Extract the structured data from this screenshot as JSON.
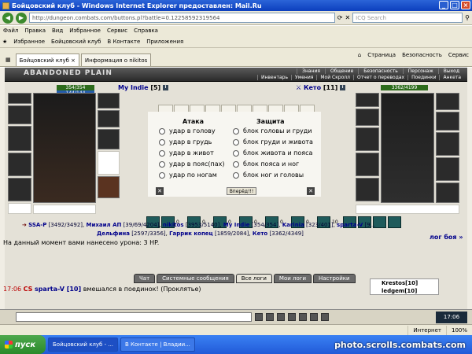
{
  "window": {
    "title": "Бойцовский клуб - Windows Internet Explorer предоставлен: Mail.Ru"
  },
  "address": {
    "url": "http://dungeon.combats.com/buttons.pl?battle=0.12258592319564",
    "search_placeholder": "ICQ Search"
  },
  "menu": [
    "Файл",
    "Правка",
    "Вид",
    "Избранное",
    "Сервис",
    "Справка"
  ],
  "favorites": {
    "label": "Избранное",
    "items": [
      "Бойцовский клуб",
      "В Контакте",
      "Приложения"
    ]
  },
  "tabs": [
    {
      "label": "Бойцовский клуб"
    },
    {
      "label": "Информация о nikitos"
    }
  ],
  "tab_tools": [
    "Страница",
    "Безопасность",
    "Сервис"
  ],
  "game": {
    "logo": "ABANDONED PLAIN",
    "nav_top": [
      "Знания",
      "Общение",
      "Безопасность",
      "Персонаж",
      "Выход"
    ],
    "nav_bottom": [
      "Инвентарь",
      "Умения",
      "Мой Скролл",
      "Отчет о переводах",
      "Поединки",
      "Анкета"
    ],
    "left_player": {
      "name": "My Indie",
      "level": "[5]",
      "hp": "354/354",
      "mana": "144/144"
    },
    "right_player": {
      "name": "Кето",
      "level": "[11]",
      "hp": "3362/4199"
    },
    "attack_header": "Атака",
    "defense_header": "Защита",
    "attack_options": [
      "удар в голову",
      "удар в грудь",
      "удар в живот",
      "удар в пояс(пах)",
      "удар по ногам"
    ],
    "defense_options": [
      "блок головы и груди",
      "блок груди и живота",
      "блок живота и пояса",
      "блок пояса и ног",
      "блок ног и головы"
    ],
    "submit": "Вперёд!!!",
    "spell_counts": [
      "0",
      "0",
      "0",
      "0",
      "0",
      "0",
      "10"
    ],
    "team_line1": [
      {
        "name": "SSA-P",
        "hp": "[3492/3492]"
      },
      {
        "name": "Михаил АП",
        "hp": "[39/69/4204]"
      },
      {
        "name": "nikitos",
        "hp": "[3953/5140]"
      },
      {
        "name": "My Indie",
        "hp": "[354/354]"
      },
      {
        "name": "Karinia",
        "hp": "[323/401]"
      },
      {
        "name": "sparta-V",
        "hp": "[9..."
      }
    ],
    "team_line2": [
      {
        "name": "Дельфина",
        "hp": "[2597/3356]"
      },
      {
        "name": "Гаррик копец",
        "hp": "[1859/2084]"
      },
      {
        "name": "Кето",
        "hp": "[3362/4349]"
      }
    ],
    "damage_text": "На данный момент вами нанесено урона: 3 HP.",
    "log_link": "лог боя »",
    "chat_tabs": [
      "Чат",
      "Системные сообщения",
      "Все логи",
      "Мои логи",
      "Настройки"
    ],
    "chat": {
      "time": "17:06",
      "clan": "CS",
      "user": "sparta-V [10]",
      "text": "вмешался в поединок! (Проклятье)"
    },
    "roster": [
      "Krestos[10]",
      "ledgem[10]"
    ]
  },
  "statusbar": {
    "zone": "Интернет",
    "zoom": "100%"
  },
  "clock": "17:06",
  "taskbar": {
    "start": "пуск",
    "items": [
      "Бойцовский клуб - ...",
      "В Контакте | Владии..."
    ]
  },
  "watermark": "photo.scrolls.combats.com"
}
